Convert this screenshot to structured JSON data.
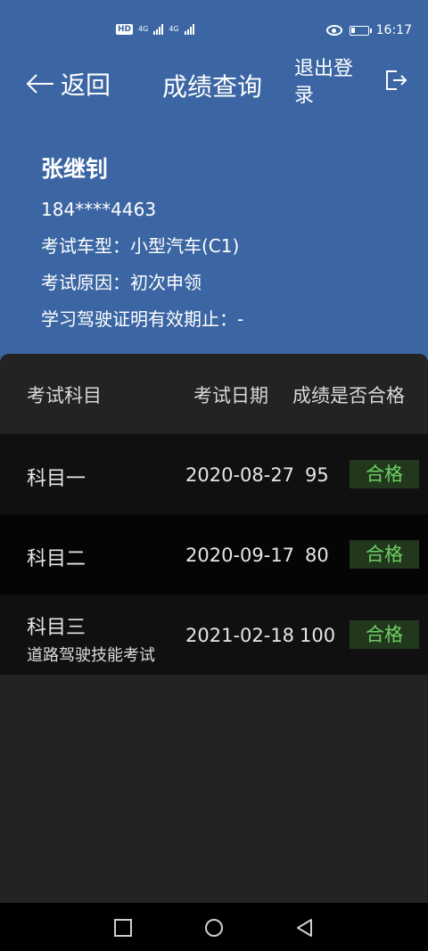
{
  "status": {
    "hd": "HD",
    "sig1": "4G",
    "sig2": "4G",
    "time": "16:17"
  },
  "nav": {
    "back_label": "返回",
    "title": "成绩查询",
    "logout_label": "退出登录"
  },
  "user": {
    "name": "张继钊",
    "phone": "184****4463",
    "vehicle_type": "考试车型：小型汽车(C1)",
    "exam_reason": "考试原因：初次申领",
    "permit_expiry": "学习驾驶证明有效期止：-"
  },
  "table": {
    "headers": {
      "subject": "考试科目",
      "date": "考试日期",
      "score_pass": "成绩是否合格"
    },
    "rows": [
      {
        "subject": "科目一",
        "date": "2020-08-27",
        "score": "95",
        "status": "合格"
      },
      {
        "subject": "科目二",
        "date": "2020-09-17",
        "score": "80",
        "status": "合格"
      },
      {
        "subject": "科目三",
        "subtitle": "道路驾驶技能考试",
        "date": "2021-02-18",
        "score": "100",
        "status": "合格"
      }
    ]
  },
  "colors": {
    "header_bg": "#3b66a3",
    "pass_text": "#6ed063",
    "pass_bg": "#21381d"
  }
}
